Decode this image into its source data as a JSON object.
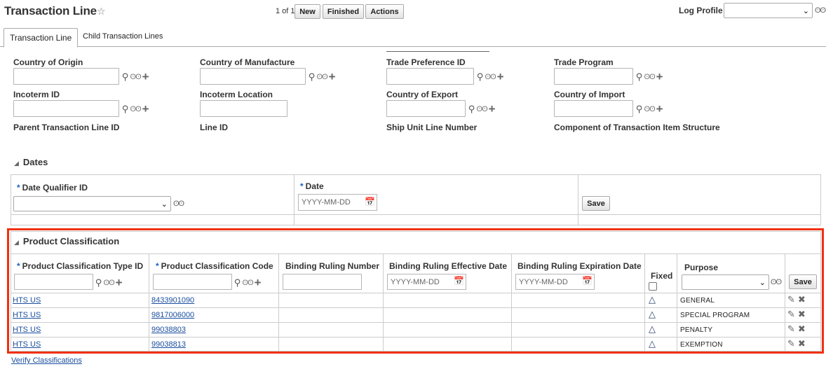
{
  "header": {
    "title": "Transaction Line",
    "pager": "1 of 1",
    "buttons": {
      "new": "New",
      "finished": "Finished",
      "actions": "Actions"
    },
    "log_profile_label": "Log Profile",
    "log_profile_value": ""
  },
  "tabs": [
    {
      "label": "Transaction Line",
      "active": true
    },
    {
      "label": "Child Transaction Lines",
      "active": false
    }
  ],
  "fields": {
    "country_of_origin": {
      "label": "Country of Origin",
      "value": ""
    },
    "country_of_manufacture": {
      "label": "Country of Manufacture",
      "value": ""
    },
    "trade_preference_id": {
      "label": "Trade Preference ID",
      "value": ""
    },
    "trade_program": {
      "label": "Trade Program",
      "value": ""
    },
    "incoterm_id": {
      "label": "Incoterm ID",
      "value": ""
    },
    "incoterm_location": {
      "label": "Incoterm Location",
      "value": ""
    },
    "country_of_export": {
      "label": "Country of Export",
      "value": ""
    },
    "country_of_import": {
      "label": "Country of Import",
      "value": ""
    },
    "parent_transaction_line_id": {
      "label": "Parent Transaction Line ID"
    },
    "line_id": {
      "label": "Line ID"
    },
    "ship_unit_line_number": {
      "label": "Ship Unit Line Number"
    },
    "component_structure": {
      "label": "Component of Transaction Item Structure"
    }
  },
  "dates": {
    "section_title": "Dates",
    "qualifier_label": "Date Qualifier ID",
    "qualifier_value": "",
    "date_label": "Date",
    "date_placeholder": "YYYY-MM-DD",
    "save_label": "Save"
  },
  "product_classification": {
    "section_title": "Product Classification",
    "headers": {
      "type_id": "Product Classification Type ID",
      "code": "Product Classification Code",
      "binding_ruling_number": "Binding Ruling Number",
      "binding_ruling_effective": "Binding Ruling Effective Date",
      "binding_ruling_expiration": "Binding Ruling Expiration Date",
      "fixed": "Fixed",
      "purpose": "Purpose"
    },
    "date_placeholder": "YYYY-MM-DD",
    "save_label": "Save",
    "rows": [
      {
        "type_id": "HTS US",
        "code": "8433901090",
        "purpose": "GENERAL"
      },
      {
        "type_id": "HTS US",
        "code": "9817006000",
        "purpose": "SPECIAL PROGRAM"
      },
      {
        "type_id": "HTS US",
        "code": "99038803",
        "purpose": "PENALTY"
      },
      {
        "type_id": "HTS US",
        "code": "99038813",
        "purpose": "EXEMPTION"
      }
    ]
  },
  "footer": {
    "verify_link": "Verify Classifications"
  },
  "colors": {
    "highlight_frame": "#f03010",
    "link": "#1a4d9e",
    "required": "#1d5fc9"
  },
  "icons": [
    "star-icon",
    "search-icon",
    "glasses-icon",
    "plus-icon",
    "calendar-icon",
    "collapse-triangle-icon",
    "delta-icon",
    "edit-icon",
    "delete-icon",
    "chevron-down-icon"
  ]
}
